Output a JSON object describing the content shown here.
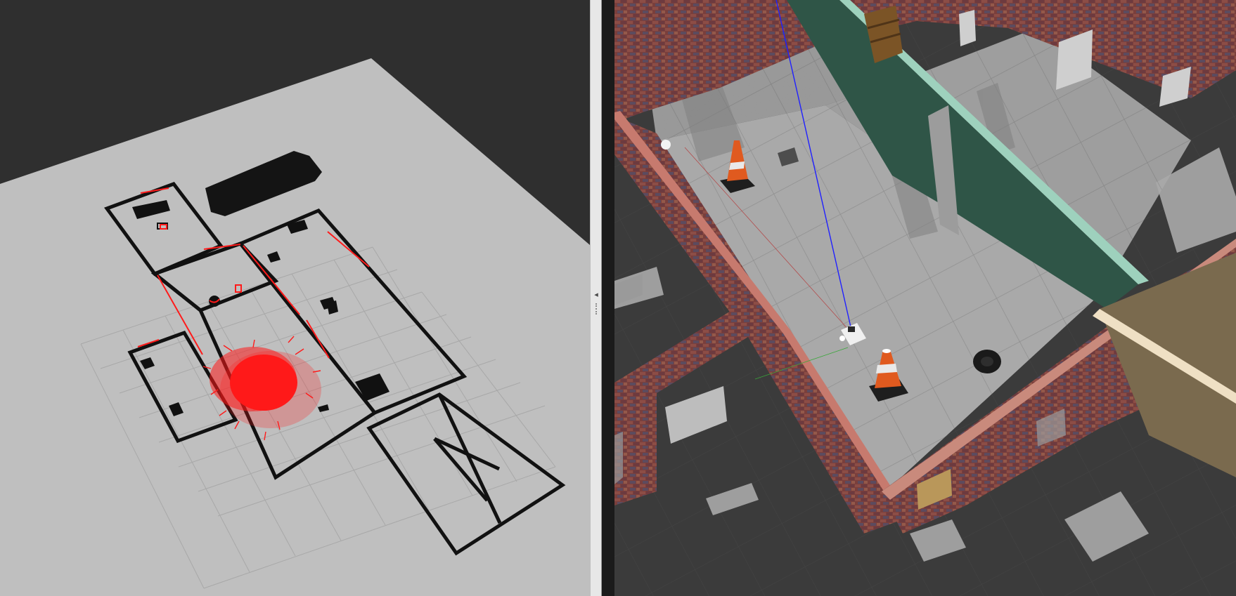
{
  "window": {
    "title": ""
  },
  "rviz_panel": {
    "name": "rviz-3d-view",
    "background_color": "#2f2f2f",
    "ground_color": "#bfbfbf",
    "wall_color": "#111111",
    "particle_color": "#ff1a1a",
    "grid_color": "#a8a8a8"
  },
  "splitter": {
    "handle_glyph": "◂",
    "color": "#e7e7e7"
  },
  "gazebo_panel": {
    "name": "gazebo-3d-view",
    "floor_color": "#a7a7a7",
    "brick_color": "#8a4a46",
    "green_wall_color": "#2f5547",
    "cone_color": "#e05a1f",
    "laser_line_color": "#2020ff"
  }
}
